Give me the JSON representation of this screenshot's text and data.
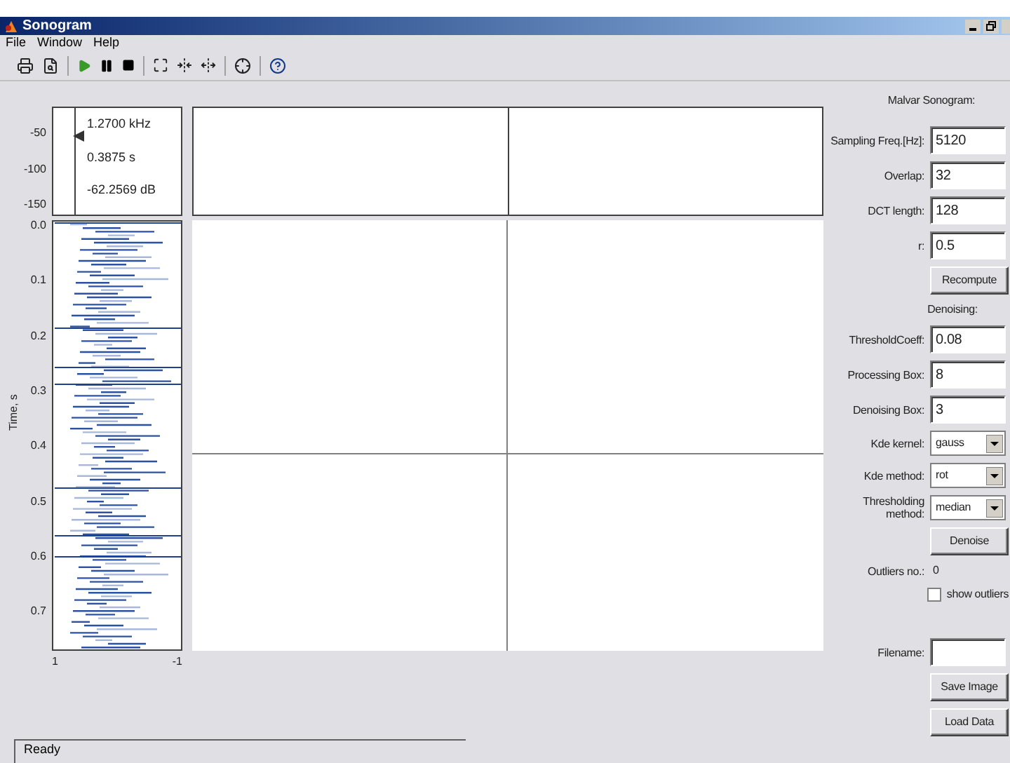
{
  "window": {
    "title": "Sonogram"
  },
  "menu": [
    "File",
    "Window",
    "Help"
  ],
  "level_plot": {
    "yticks": [
      "-50",
      "-100",
      "-150"
    ],
    "readouts": [
      "1.2700 kHz",
      "0.3875 s",
      "-62.2569 dB"
    ]
  },
  "time_plot": {
    "ylabel": "Time, s",
    "yticks": [
      "0.0",
      "0.1",
      "0.2",
      "0.3",
      "0.4",
      "0.5",
      "0.6",
      "0.7"
    ],
    "xticks": [
      "1",
      "-1"
    ]
  },
  "panel": {
    "title": "Malvar Sonogram:",
    "rows": [
      {
        "kind": "field",
        "label": "Sampling Freq.[Hz]:",
        "value": "5120"
      },
      {
        "kind": "field",
        "label": "Overlap:",
        "value": "32"
      },
      {
        "kind": "field",
        "label": "DCT length:",
        "value": "128"
      },
      {
        "kind": "field",
        "label": "r:",
        "value": "0.5"
      },
      {
        "kind": "button",
        "label": "Recompute"
      },
      {
        "kind": "heading",
        "label": "Denoising:"
      },
      {
        "kind": "field",
        "label": "ThresholdCoeff:",
        "value": "0.08"
      },
      {
        "kind": "field",
        "label": "Processing Box:",
        "value": "8"
      },
      {
        "kind": "field",
        "label": "Denoising Box:",
        "value": "3"
      },
      {
        "kind": "select",
        "label": "Kde kernel:",
        "value": "gauss"
      },
      {
        "kind": "select",
        "label": "Kde method:",
        "value": "rot"
      },
      {
        "kind": "select",
        "label": "Thresholding method:",
        "value": "median"
      },
      {
        "kind": "button",
        "label": "Denoise"
      },
      {
        "kind": "info",
        "label": "Outliers no.:",
        "value": "0"
      },
      {
        "kind": "checkbox",
        "label": "show outliers",
        "checked": false
      }
    ],
    "file_rows": [
      {
        "kind": "field",
        "label": "Filename:"
      },
      {
        "kind": "button",
        "label": "Save Image"
      },
      {
        "kind": "button",
        "label": "Load Data"
      }
    ]
  },
  "status_bar": "Ready"
}
